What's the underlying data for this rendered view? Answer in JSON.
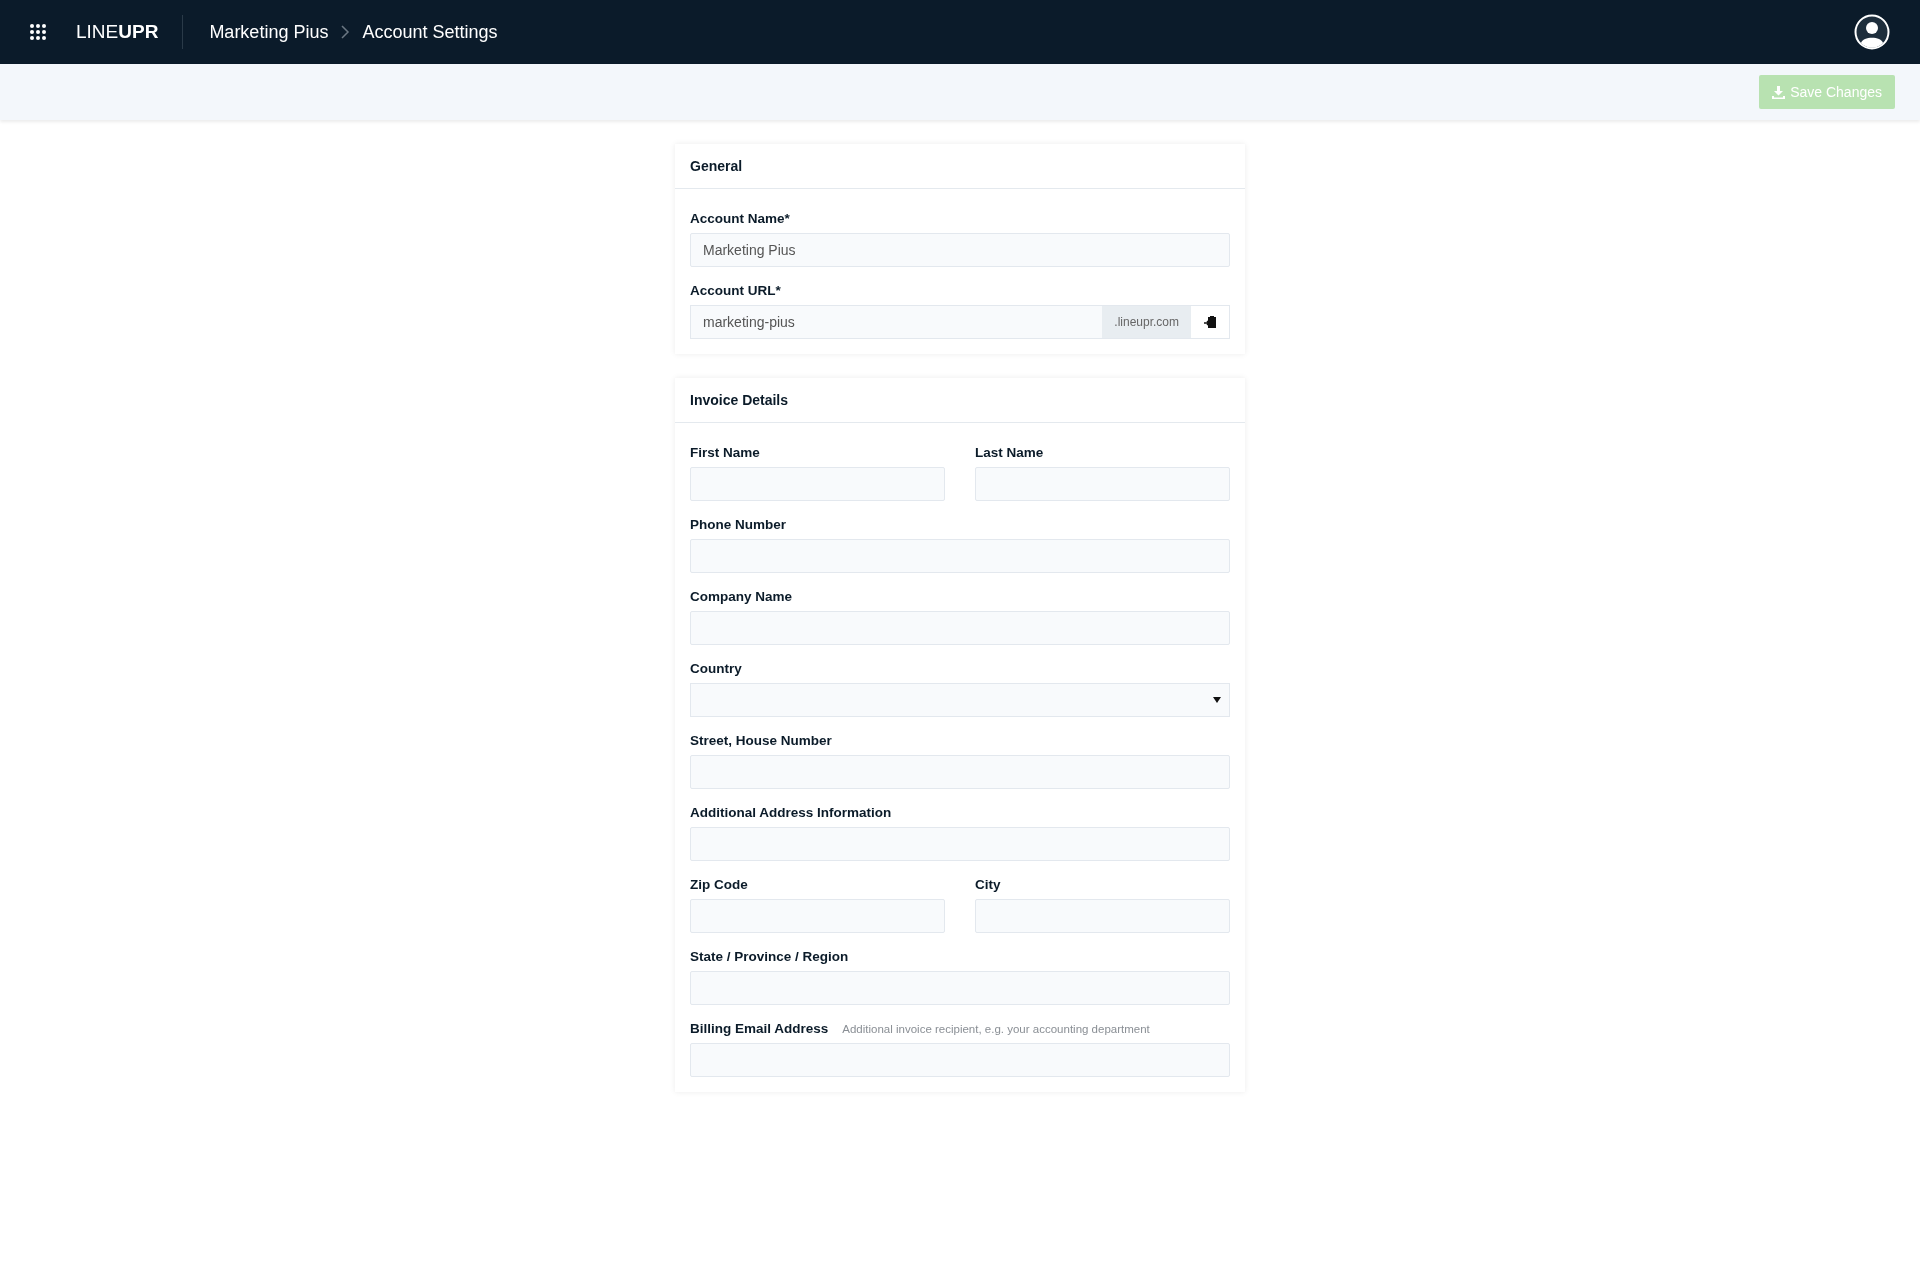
{
  "header": {
    "logo": "LINE**UPR**",
    "breadcrumbs": [
      "Marketing Pius",
      "Account Settings"
    ]
  },
  "toolbar": {
    "save_button": {
      "label": "Save Changes",
      "disabled": true
    }
  },
  "sections": [
    {
      "title": "General",
      "rows": [
        [
          {
            "kind": "text",
            "label": "Account Name*",
            "value": "Marketing Pius"
          }
        ],
        [
          {
            "kind": "url",
            "label": "Account URL*",
            "value": "marketing-pius",
            "suffix": ".lineupr.com"
          }
        ]
      ]
    },
    {
      "title": "Invoice Details",
      "rows": [
        [
          {
            "kind": "text",
            "label": "First Name"
          },
          {
            "kind": "text",
            "label": "Last Name"
          }
        ],
        [
          {
            "kind": "text",
            "label": "Phone Number"
          }
        ],
        [
          {
            "kind": "text",
            "label": "Company Name"
          }
        ],
        [
          {
            "kind": "select",
            "label": "Country"
          }
        ],
        [
          {
            "kind": "text",
            "label": "Street, House Number"
          }
        ],
        [
          {
            "kind": "text",
            "label": "Additional Address Information"
          }
        ],
        [
          {
            "kind": "text",
            "label": "Zip Code"
          },
          {
            "kind": "text",
            "label": "City"
          }
        ],
        [
          {
            "kind": "text",
            "label": "State / Province / Region"
          }
        ],
        [
          {
            "kind": "text",
            "label": "Billing Email Address",
            "hint": "Additional invoice recipient, e.g. your accounting department"
          }
        ]
      ]
    }
  ]
}
